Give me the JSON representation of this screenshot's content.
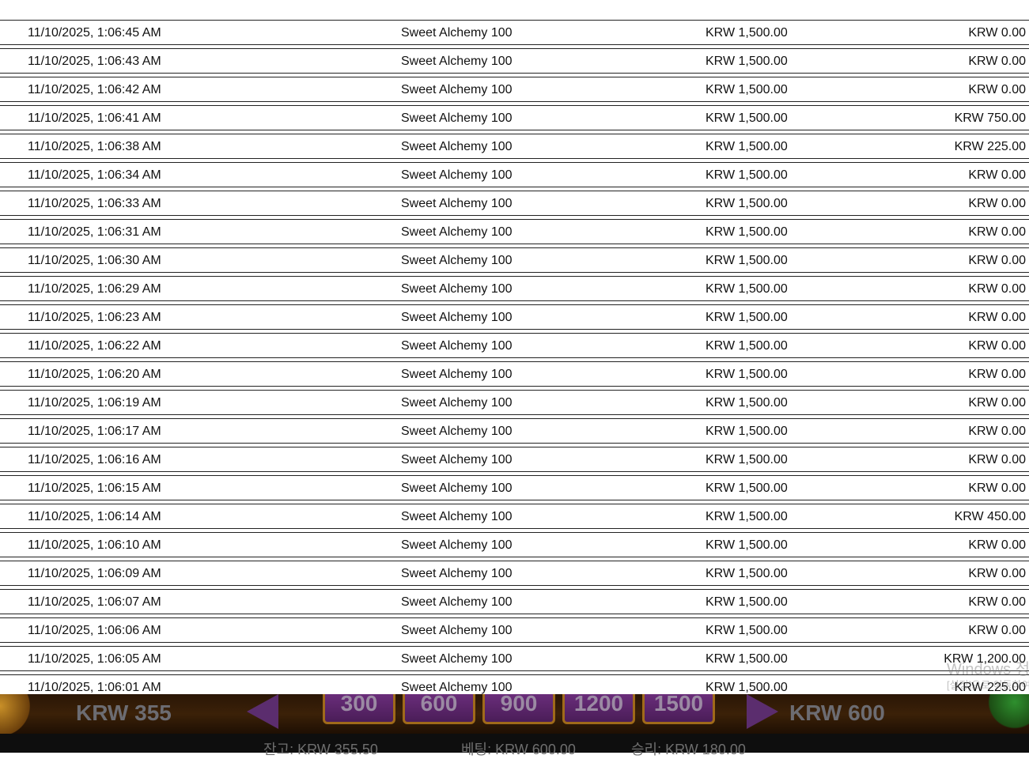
{
  "history": {
    "rows": [
      {
        "date": "11/10/2025, 1:06:45 AM",
        "game": "Sweet Alchemy 100",
        "bet": "KRW 1,500.00",
        "win": "KRW 0.00"
      },
      {
        "date": "11/10/2025, 1:06:43 AM",
        "game": "Sweet Alchemy 100",
        "bet": "KRW 1,500.00",
        "win": "KRW 0.00"
      },
      {
        "date": "11/10/2025, 1:06:42 AM",
        "game": "Sweet Alchemy 100",
        "bet": "KRW 1,500.00",
        "win": "KRW 0.00"
      },
      {
        "date": "11/10/2025, 1:06:41 AM",
        "game": "Sweet Alchemy 100",
        "bet": "KRW 1,500.00",
        "win": "KRW 750.00"
      },
      {
        "date": "11/10/2025, 1:06:38 AM",
        "game": "Sweet Alchemy 100",
        "bet": "KRW 1,500.00",
        "win": "KRW 225.00"
      },
      {
        "date": "11/10/2025, 1:06:34 AM",
        "game": "Sweet Alchemy 100",
        "bet": "KRW 1,500.00",
        "win": "KRW 0.00"
      },
      {
        "date": "11/10/2025, 1:06:33 AM",
        "game": "Sweet Alchemy 100",
        "bet": "KRW 1,500.00",
        "win": "KRW 0.00"
      },
      {
        "date": "11/10/2025, 1:06:31 AM",
        "game": "Sweet Alchemy 100",
        "bet": "KRW 1,500.00",
        "win": "KRW 0.00"
      },
      {
        "date": "11/10/2025, 1:06:30 AM",
        "game": "Sweet Alchemy 100",
        "bet": "KRW 1,500.00",
        "win": "KRW 0.00"
      },
      {
        "date": "11/10/2025, 1:06:29 AM",
        "game": "Sweet Alchemy 100",
        "bet": "KRW 1,500.00",
        "win": "KRW 0.00"
      },
      {
        "date": "11/10/2025, 1:06:23 AM",
        "game": "Sweet Alchemy 100",
        "bet": "KRW 1,500.00",
        "win": "KRW 0.00"
      },
      {
        "date": "11/10/2025, 1:06:22 AM",
        "game": "Sweet Alchemy 100",
        "bet": "KRW 1,500.00",
        "win": "KRW 0.00"
      },
      {
        "date": "11/10/2025, 1:06:20 AM",
        "game": "Sweet Alchemy 100",
        "bet": "KRW 1,500.00",
        "win": "KRW 0.00"
      },
      {
        "date": "11/10/2025, 1:06:19 AM",
        "game": "Sweet Alchemy 100",
        "bet": "KRW 1,500.00",
        "win": "KRW 0.00"
      },
      {
        "date": "11/10/2025, 1:06:17 AM",
        "game": "Sweet Alchemy 100",
        "bet": "KRW 1,500.00",
        "win": "KRW 0.00"
      },
      {
        "date": "11/10/2025, 1:06:16 AM",
        "game": "Sweet Alchemy 100",
        "bet": "KRW 1,500.00",
        "win": "KRW 0.00"
      },
      {
        "date": "11/10/2025, 1:06:15 AM",
        "game": "Sweet Alchemy 100",
        "bet": "KRW 1,500.00",
        "win": "KRW 0.00"
      },
      {
        "date": "11/10/2025, 1:06:14 AM",
        "game": "Sweet Alchemy 100",
        "bet": "KRW 1,500.00",
        "win": "KRW 450.00"
      },
      {
        "date": "11/10/2025, 1:06:10 AM",
        "game": "Sweet Alchemy 100",
        "bet": "KRW 1,500.00",
        "win": "KRW 0.00"
      },
      {
        "date": "11/10/2025, 1:06:09 AM",
        "game": "Sweet Alchemy 100",
        "bet": "KRW 1,500.00",
        "win": "KRW 0.00"
      },
      {
        "date": "11/10/2025, 1:06:07 AM",
        "game": "Sweet Alchemy 100",
        "bet": "KRW 1,500.00",
        "win": "KRW 0.00"
      },
      {
        "date": "11/10/2025, 1:06:06 AM",
        "game": "Sweet Alchemy 100",
        "bet": "KRW 1,500.00",
        "win": "KRW 0.00"
      },
      {
        "date": "11/10/2025, 1:06:05 AM",
        "game": "Sweet Alchemy 100",
        "bet": "KRW 1,500.00",
        "win": "KRW 1,200.00"
      },
      {
        "date": "11/10/2025, 1:06:01 AM",
        "game": "Sweet Alchemy 100",
        "bet": "KRW 1,500.00",
        "win": "KRW 225.00"
      }
    ]
  },
  "watermark": {
    "line1": "Windows 정품 인증",
    "line2": "[설정]으로 이동하여 Windows를 정품 인증합니다."
  },
  "game": {
    "balance_short": "KRW 355",
    "bet_current": "KRW 600",
    "chips": [
      "300",
      "600",
      "900",
      "1200",
      "1500"
    ],
    "arrow_left_icon": "arrow-left-icon",
    "arrow_right_icon": "arrow-right-icon"
  },
  "status": {
    "balance": "잔고: KRW 355.50",
    "bet": "베팅: KRW 600.00",
    "win": "승리: KRW 180.00"
  },
  "colors": {
    "row_border": "#222222",
    "strip_bg": "#2a1606",
    "chip_purple": "#5b2d6e",
    "chip_gold": "#a06a1a",
    "status_bg": "#0e0e0e"
  }
}
